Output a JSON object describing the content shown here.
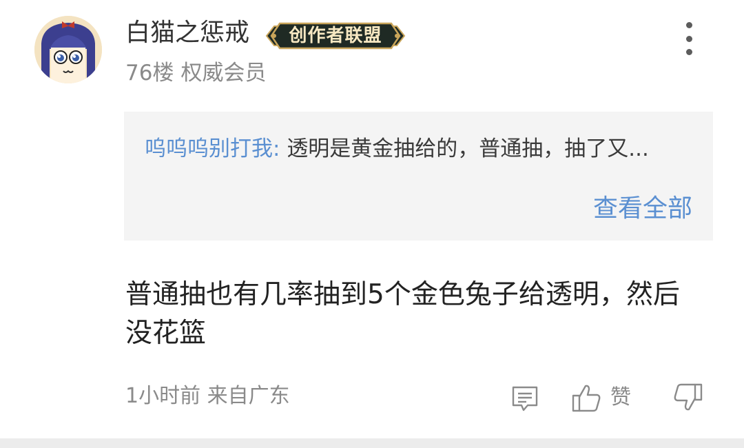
{
  "comment": {
    "user": {
      "name": "白猫之惩戒",
      "badge": "创作者联盟",
      "avatar_icon": "anime-girl-avatar"
    },
    "floor": "76楼",
    "member_level": "权威会员",
    "quote": {
      "author": "呜呜呜别打我:",
      "text": "透明是黄金抽给的，普通抽，抽了又...",
      "view_all": "查看全部"
    },
    "body": "普通抽也有几率抽到5个金色兔子给透明，然后没花篮",
    "time": "1小时前",
    "location": "来自广东",
    "actions": {
      "reply_icon": "comment-icon",
      "like_icon": "thumbs-up-icon",
      "like_label": "赞",
      "dislike_icon": "thumbs-down-icon",
      "more_icon": "more-vertical-icon"
    }
  },
  "colors": {
    "link_blue": "#5a8fd1",
    "meta_gray": "#8a8a8a",
    "quote_bg": "#f4f4f4",
    "badge_dark": "#1f2a24",
    "badge_gold": "#c9a55a"
  }
}
